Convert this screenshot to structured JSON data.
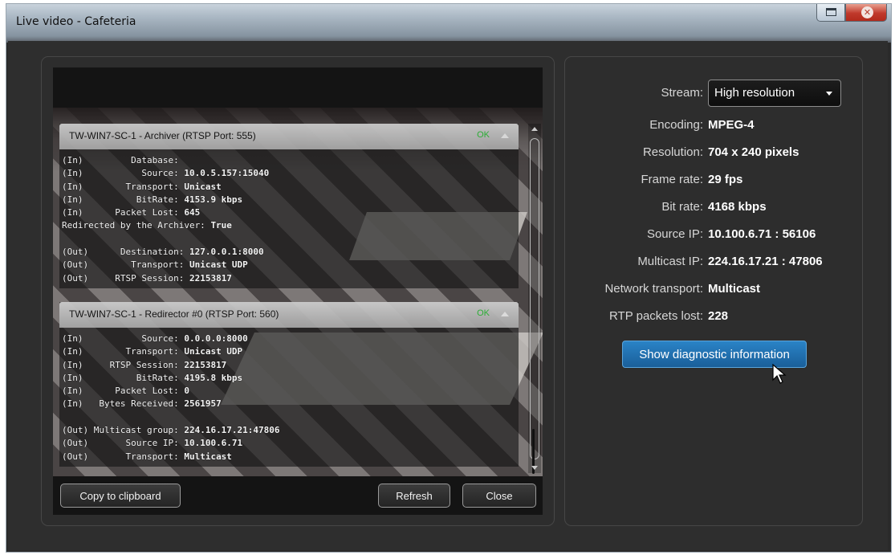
{
  "window": {
    "title": "Live video - Cafeteria"
  },
  "diagnostics": {
    "sections": [
      {
        "title": "TW-WIN7-SC-1 - Archiver (RTSP Port: 555)",
        "status": "OK",
        "lines": [
          [
            "(In)         Database:",
            ""
          ],
          [
            "(In)           Source: ",
            "10.0.5.157:15040"
          ],
          [
            "(In)        Transport: ",
            "Unicast"
          ],
          [
            "(In)          BitRate: ",
            "4153.9 kbps"
          ],
          [
            "(In)      Packet Lost: ",
            "645"
          ],
          [
            "Redirected by the Archiver: ",
            "True"
          ],
          [
            "",
            ""
          ],
          [
            "(Out)      Destination: ",
            "127.0.0.1:8000"
          ],
          [
            "(Out)        Transport: ",
            "Unicast UDP"
          ],
          [
            "(Out)     RTSP Session: ",
            "22153817"
          ]
        ]
      },
      {
        "title": "TW-WIN7-SC-1 - Redirector #0 (RTSP Port: 560)",
        "status": "OK",
        "lines": [
          [
            "(In)           Source: ",
            "0.0.0.0:8000"
          ],
          [
            "(In)        Transport: ",
            "Unicast UDP"
          ],
          [
            "(In)     RTSP Session: ",
            "22153817"
          ],
          [
            "(In)          BitRate: ",
            "4195.8 kbps"
          ],
          [
            "(In)      Packet Lost: ",
            "0"
          ],
          [
            "(In)   Bytes Received: ",
            "2561957"
          ],
          [
            "",
            ""
          ],
          [
            "(Out) Multicast group: ",
            "224.16.17.21:47806"
          ],
          [
            "(Out)       Source IP: ",
            "10.100.6.71"
          ],
          [
            "(Out)       Transport: ",
            "Multicast"
          ]
        ]
      }
    ],
    "buttons": {
      "copy": "Copy to clipboard",
      "refresh": "Refresh",
      "close": "Close"
    }
  },
  "properties": {
    "stream": {
      "label": "Stream:",
      "value": "High resolution"
    },
    "items": [
      {
        "label": "Encoding:",
        "value": "MPEG-4"
      },
      {
        "label": "Resolution:",
        "value": "704 x 240 pixels"
      },
      {
        "label": "Frame rate:",
        "value": "29 fps"
      },
      {
        "label": "Bit rate:",
        "value": "4168 kbps"
      },
      {
        "label": "Source IP:",
        "value": "10.100.6.71 : 56106"
      },
      {
        "label": "Multicast IP:",
        "value": "224.16.17.21 : 47806"
      },
      {
        "label": "Network transport:",
        "value": "Multicast"
      },
      {
        "label": "RTP packets lost:",
        "value": "228"
      }
    ],
    "diagnostic_button": "Show diagnostic information"
  }
}
